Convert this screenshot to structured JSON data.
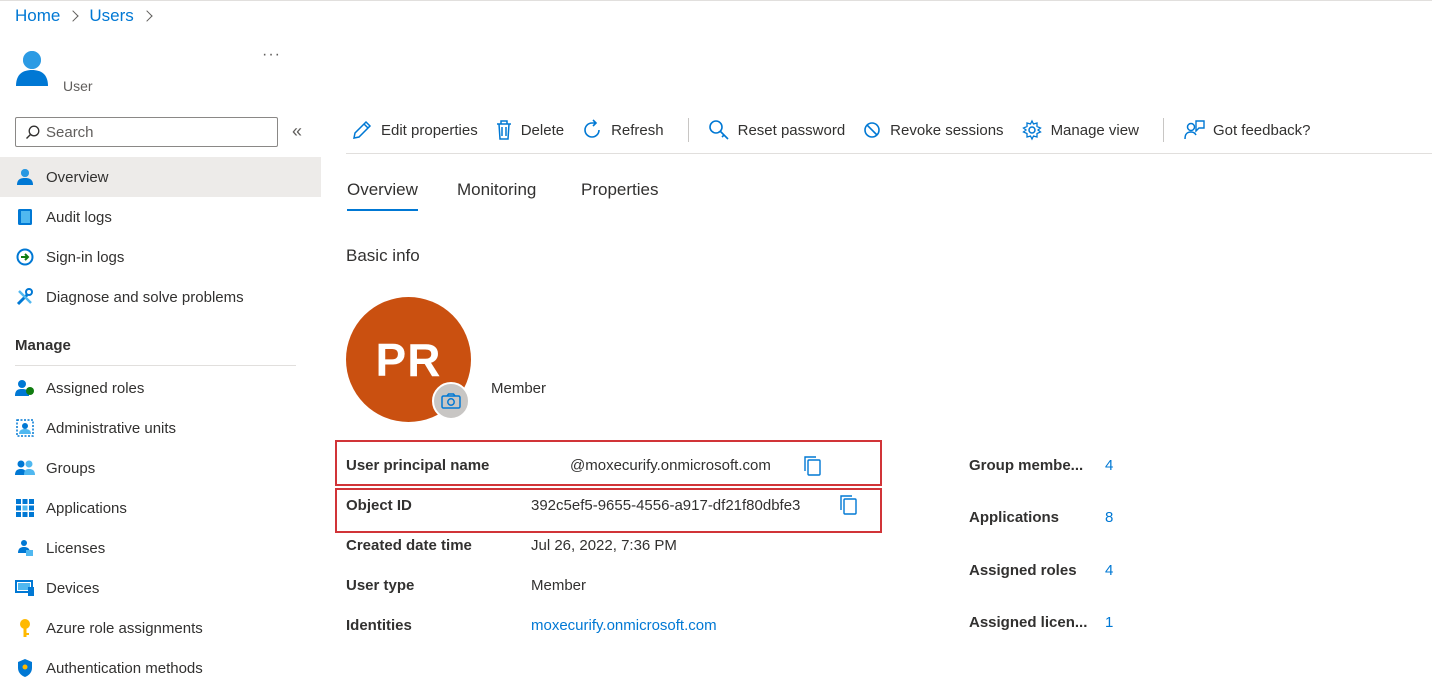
{
  "breadcrumb": [
    "Home",
    "Users"
  ],
  "header": {
    "subtitle": "User",
    "more": "···"
  },
  "search": {
    "placeholder": "Search"
  },
  "sidebar": {
    "collapse_glyph": "«",
    "items": [
      {
        "label": "Overview",
        "icon": "user-icon",
        "active": true
      },
      {
        "label": "Audit logs",
        "icon": "book-icon"
      },
      {
        "label": "Sign-in logs",
        "icon": "sign-in-icon"
      },
      {
        "label": "Diagnose and solve problems",
        "icon": "wrench-icon"
      }
    ],
    "manage_heading": "Manage",
    "manage_items": [
      {
        "label": "Assigned roles",
        "icon": "roles-icon"
      },
      {
        "label": "Administrative units",
        "icon": "admin-units-icon"
      },
      {
        "label": "Groups",
        "icon": "groups-icon"
      },
      {
        "label": "Applications",
        "icon": "apps-grid-icon"
      },
      {
        "label": "Licenses",
        "icon": "license-icon"
      },
      {
        "label": "Devices",
        "icon": "device-icon"
      },
      {
        "label": "Azure role assignments",
        "icon": "key-icon"
      },
      {
        "label": "Authentication methods",
        "icon": "shield-icon"
      }
    ]
  },
  "toolbar": {
    "edit": "Edit properties",
    "delete": "Delete",
    "refresh": "Refresh",
    "reset": "Reset password",
    "revoke": "Revoke sessions",
    "manage_view": "Manage view",
    "feedback": "Got feedback?"
  },
  "tabs": [
    "Overview",
    "Monitoring",
    "Properties"
  ],
  "basic_info": {
    "title": "Basic info",
    "initials": "PR",
    "user_type_label": "Member",
    "properties": [
      {
        "label": "User principal name",
        "value": "@moxecurify.onmicrosoft.com",
        "copy": true
      },
      {
        "label": "Object ID",
        "value": "392c5ef5-9655-4556-a917-df21f80dbfe3",
        "copy": true
      },
      {
        "label": "Created date time",
        "value": "Jul 26, 2022, 7:36 PM"
      },
      {
        "label": "User type",
        "value": "Member"
      },
      {
        "label": "Identities",
        "value": "moxecurify.onmicrosoft.com",
        "link": true
      }
    ],
    "stats": [
      {
        "label": "Group membe...",
        "value": "4"
      },
      {
        "label": "Applications",
        "value": "8"
      },
      {
        "label": "Assigned roles",
        "value": "4"
      },
      {
        "label": "Assigned licen...",
        "value": "1"
      }
    ]
  },
  "colors": {
    "accent": "#0078d4",
    "avatar": "#ca5010",
    "highlight": "#d13438"
  }
}
